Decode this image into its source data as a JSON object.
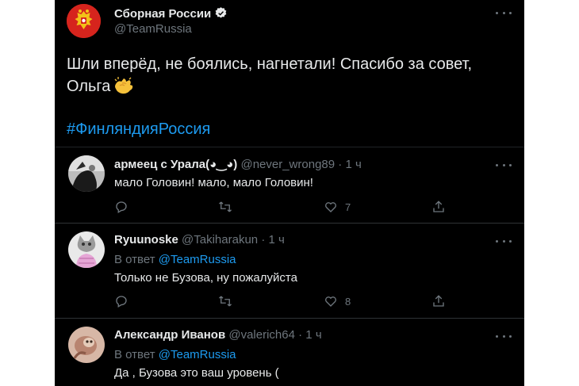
{
  "main_tweet": {
    "author_name": "Сборная России",
    "author_handle": "@TeamRussia",
    "text": "Шли вперёд, не боялись, нагнетали! Спасибо за совет, Ольга",
    "hashtag": "#ФинляндияРоссия"
  },
  "replies": [
    {
      "name": "армеец с Урала(◕‿◕)",
      "handle": "@never_wrong89",
      "time": "· 1 ч",
      "reply_prefix": "",
      "reply_to": "",
      "text": "мало Головин! мало, мало Головин!",
      "like_count": "7"
    },
    {
      "name": "Ryuunoske",
      "handle": "@Takiharakun",
      "time": "· 1 ч",
      "reply_prefix": "В ответ",
      "reply_to": "@TeamRussia",
      "text": "Только не Бузова, ну пожалуйста",
      "like_count": "8"
    },
    {
      "name": "Александр Иванов",
      "handle": "@valerich64",
      "time": "· 1 ч",
      "reply_prefix": "В ответ",
      "reply_to": "@TeamRussia",
      "text": "Да , Бузова это ваш уровень  (",
      "like_count": ""
    }
  ],
  "icons": [
    "more-icon",
    "verified-icon",
    "clap-emoji-icon",
    "reply-icon",
    "retweet-icon",
    "like-icon",
    "share-icon"
  ],
  "colors": {
    "background": "#000000",
    "text": "#e7e9ea",
    "muted": "#6e767d",
    "link": "#1d9bf0",
    "divider": "#2f3336"
  }
}
